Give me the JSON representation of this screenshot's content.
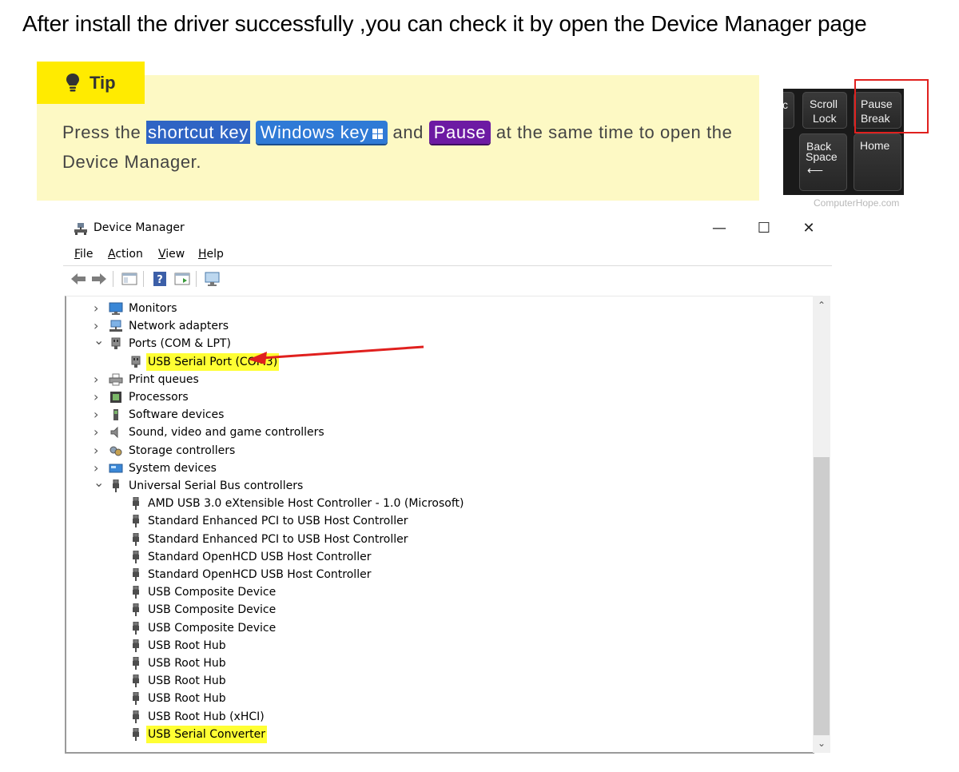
{
  "heading": "After install the driver successfully ,you can check it by open the Device Manager page",
  "tip": {
    "label": "Tip",
    "text_1": "Press the ",
    "kbd_shortcut": "shortcut key",
    "kbd_windows": "Windows key",
    "text_and": " and ",
    "kbd_pause": "Pause",
    "text_2": " at the same time to open the Device Manager."
  },
  "keyboard_image": {
    "keys": {
      "partial": "c",
      "scroll": "Scroll",
      "lock": "Lock",
      "pause": "Pause",
      "break": "Break",
      "back": "Back",
      "space": "Space",
      "home": "Home"
    },
    "credit": "ComputerHope.com"
  },
  "window": {
    "title": "Device Manager",
    "controls": {
      "minimize": "—",
      "maximize": "☐",
      "close": "✕"
    },
    "menu": [
      {
        "key": "F",
        "rest": "ile"
      },
      {
        "key": "A",
        "rest": "ction"
      },
      {
        "key": "V",
        "rest": "iew"
      },
      {
        "key": "H",
        "rest": "elp"
      }
    ],
    "tree": [
      {
        "label": "Monitors",
        "icon": "monitor-icon",
        "state": "collapsed",
        "highlight": false
      },
      {
        "label": "Network adapters",
        "icon": "network-icon",
        "state": "collapsed",
        "highlight": false
      },
      {
        "label": "Ports (COM & LPT)",
        "icon": "port-icon",
        "state": "expanded",
        "highlight": false
      },
      {
        "label": "USB Serial Port (COM3)",
        "icon": "port-icon",
        "state": "child",
        "highlight": true
      },
      {
        "label": "Print queues",
        "icon": "printer-icon",
        "state": "collapsed",
        "highlight": false
      },
      {
        "label": "Processors",
        "icon": "processor-icon",
        "state": "collapsed",
        "highlight": false
      },
      {
        "label": "Software devices",
        "icon": "software-icon",
        "state": "collapsed",
        "highlight": false
      },
      {
        "label": "Sound, video and game controllers",
        "icon": "sound-icon",
        "state": "collapsed",
        "highlight": false
      },
      {
        "label": "Storage controllers",
        "icon": "storage-icon",
        "state": "collapsed",
        "highlight": false
      },
      {
        "label": "System devices",
        "icon": "system-icon",
        "state": "collapsed",
        "highlight": false
      },
      {
        "label": "Universal Serial Bus controllers",
        "icon": "usb-icon",
        "state": "expanded",
        "highlight": false
      },
      {
        "label": "AMD USB 3.0 eXtensible Host Controller - 1.0 (Microsoft)",
        "icon": "usb-icon",
        "state": "child",
        "highlight": false
      },
      {
        "label": "Standard Enhanced PCI to USB Host Controller",
        "icon": "usb-icon",
        "state": "child",
        "highlight": false
      },
      {
        "label": "Standard Enhanced PCI to USB Host Controller",
        "icon": "usb-icon",
        "state": "child",
        "highlight": false
      },
      {
        "label": "Standard OpenHCD USB Host Controller",
        "icon": "usb-icon",
        "state": "child",
        "highlight": false
      },
      {
        "label": "Standard OpenHCD USB Host Controller",
        "icon": "usb-icon",
        "state": "child",
        "highlight": false
      },
      {
        "label": "USB Composite Device",
        "icon": "usb-icon",
        "state": "child",
        "highlight": false
      },
      {
        "label": "USB Composite Device",
        "icon": "usb-icon",
        "state": "child",
        "highlight": false
      },
      {
        "label": "USB Composite Device",
        "icon": "usb-icon",
        "state": "child",
        "highlight": false
      },
      {
        "label": "USB Root Hub",
        "icon": "usb-icon",
        "state": "child",
        "highlight": false
      },
      {
        "label": "USB Root Hub",
        "icon": "usb-icon",
        "state": "child",
        "highlight": false
      },
      {
        "label": "USB Root Hub",
        "icon": "usb-icon",
        "state": "child",
        "highlight": false
      },
      {
        "label": "USB Root Hub",
        "icon": "usb-icon",
        "state": "child",
        "highlight": false
      },
      {
        "label": "USB Root Hub (xHCI)",
        "icon": "usb-icon",
        "state": "child",
        "highlight": false
      },
      {
        "label": "USB Serial Converter",
        "icon": "usb-icon",
        "state": "child",
        "highlight": true
      }
    ]
  },
  "colors": {
    "tip_background": "#fdf9c4",
    "tip_tab": "#ffeb00",
    "highlight_yellow": "#ffff33",
    "annotation_red": "#e0201e",
    "windows_key": "#2f7ad6",
    "pause_key": "#6d1aa3"
  }
}
